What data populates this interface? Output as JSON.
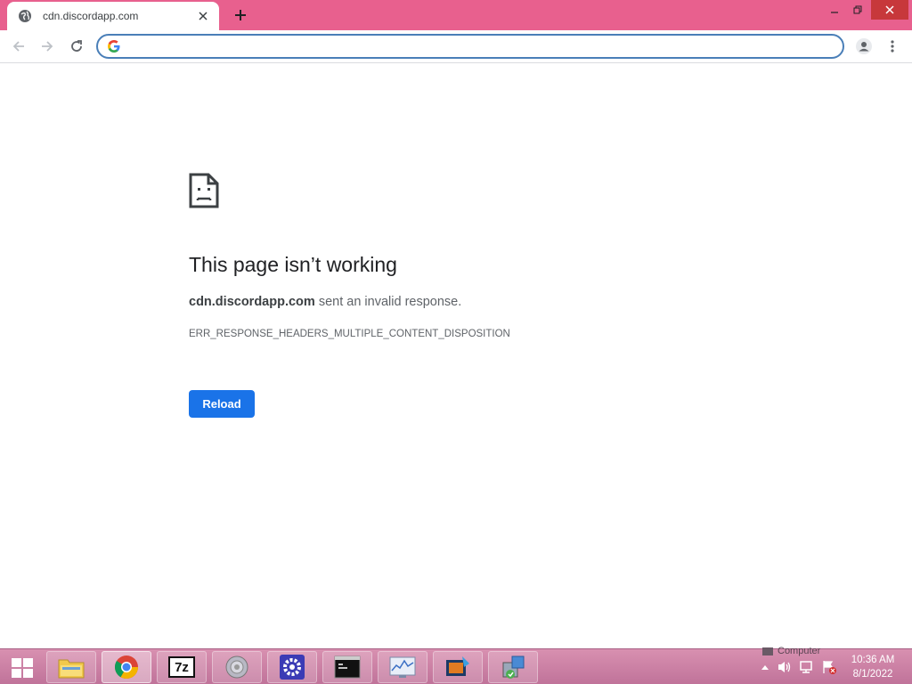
{
  "browser": {
    "tab_title": "cdn.discordapp.com",
    "omnibox_value": ""
  },
  "error_page": {
    "title": "This page isn’t working",
    "host": "cdn.discordapp.com",
    "description_suffix": " sent an invalid response.",
    "error_code": "ERR_RESPONSE_HEADERS_MULTIPLE_CONTENT_DISPOSITION",
    "reload_label": "Reload"
  },
  "taskbar": {
    "pinned": [
      {
        "name": "file-explorer-icon"
      },
      {
        "name": "chrome-icon",
        "active": true
      },
      {
        "name": "7zip-icon",
        "text": "7z"
      },
      {
        "name": "speaker-app-icon"
      },
      {
        "name": "settings-gear-icon"
      },
      {
        "name": "command-prompt-icon"
      },
      {
        "name": "performance-monitor-icon"
      },
      {
        "name": "media-app-icon"
      },
      {
        "name": "installer-icon"
      }
    ],
    "tray_overlay_text": "Computer",
    "clock_time": "10:36 AM",
    "clock_date": "8/1/2022"
  },
  "colors": {
    "titlebar": "#e8608e",
    "accent_blue": "#1a73e8",
    "omnibox_border": "#4a7fb8",
    "close_button": "#c7383b"
  }
}
